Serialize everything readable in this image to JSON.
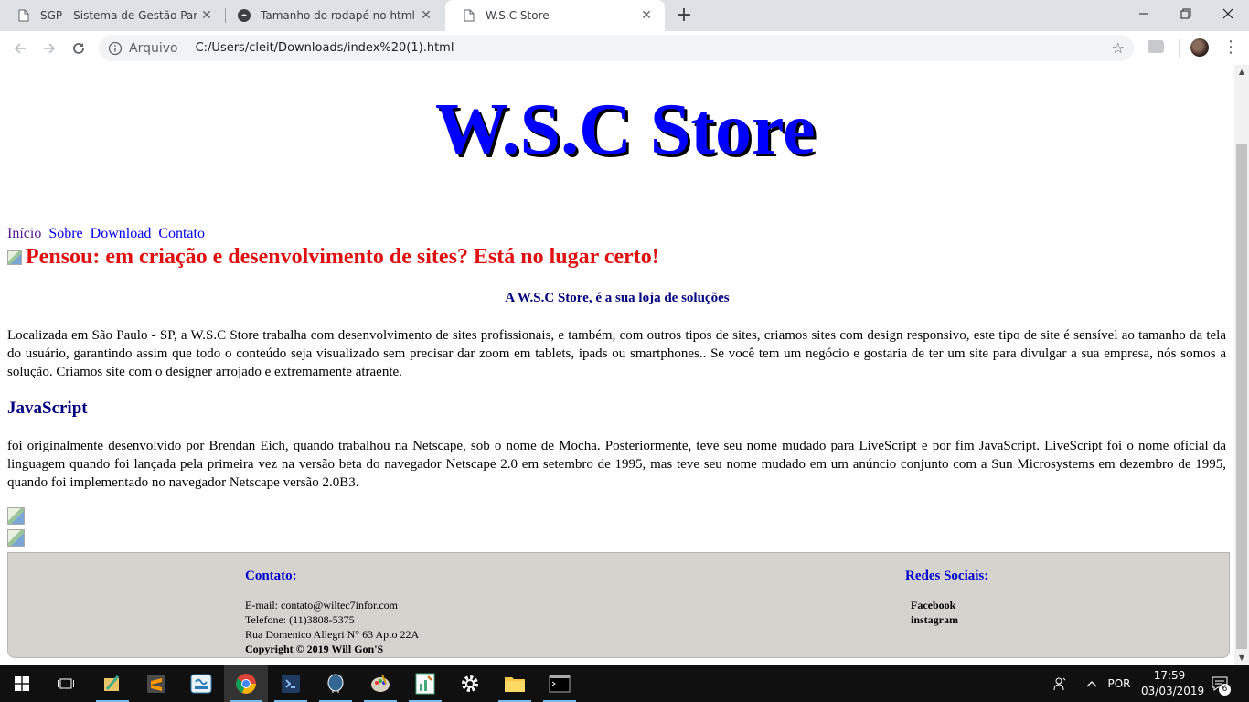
{
  "browser": {
    "tabs": [
      {
        "title": "SGP - Sistema de Gestão Para Psi",
        "active": false
      },
      {
        "title": "Tamanho do rodapé no html e C",
        "active": false
      },
      {
        "title": "W.S.C Store",
        "active": true
      }
    ],
    "scheme_label": "Arquivo",
    "url": "C:/Users/cleit/Downloads/index%20(1).html"
  },
  "page": {
    "logo": "W.S.C Store",
    "nav": [
      "Início",
      "Sobre",
      "Download",
      "Contato"
    ],
    "headline": "Pensou: em criação e desenvolvimento de sites? Está no lugar certo!",
    "subhead": "A W.S.C Store, é a sua loja de soluções",
    "paragraph1": "Localizada em São Paulo - SP, a W.S.C Store trabalha com desenvolvimento de sites profissionais, e também, com outros tipos de sites, criamos sites com design responsivo, este tipo de site é sensível ao tamanho da tela do usuário, garantindo assim que todo o conteúdo seja visualizado sem precisar dar zoom em tablets, ipads ou smartphones.. Se você tem um negócio e gostaria de ter um site para divulgar a sua empresa, nós somos a solução. Criamos site com o designer arrojado e extremamente atraente.",
    "js_title": "JavaScript",
    "paragraph2": "foi originalmente desenvolvido por Brendan Eich, quando trabalhou na Netscape, sob o nome de Mocha. Posteriormente, teve seu nome mudado para LiveScript e por fim JavaScript. LiveScript foi o nome oficial da linguagem quando foi lançada pela primeira vez na versão beta do navegador Netscape 2.0 em setembro de 1995, mas teve seu nome mudado em um anúncio conjunto com a Sun Microsystems em dezembro de 1995, quando foi implementado no navegador Netscape versão 2.0B3.",
    "footer": {
      "contact_title": "Contato:",
      "email": "E-mail: contato@wiltec7infor.com",
      "phone": "Telefone: (11)3808-5375",
      "address": "Rua Domenico Allegri N° 63 Apto 22A",
      "copyright": "Copyright © 2019 Will Gon'S",
      "social_title": "Redes Sociais:",
      "social": [
        "Facebook",
        "instagram"
      ]
    }
  },
  "taskbar": {
    "language": "POR",
    "time": "17:59",
    "date": "03/03/2019",
    "notifications": "6"
  },
  "colors": {
    "logo": "#0000ff",
    "headline": "#e01010",
    "subhead": "#000080",
    "footer_bg": "#d6d3ce"
  }
}
